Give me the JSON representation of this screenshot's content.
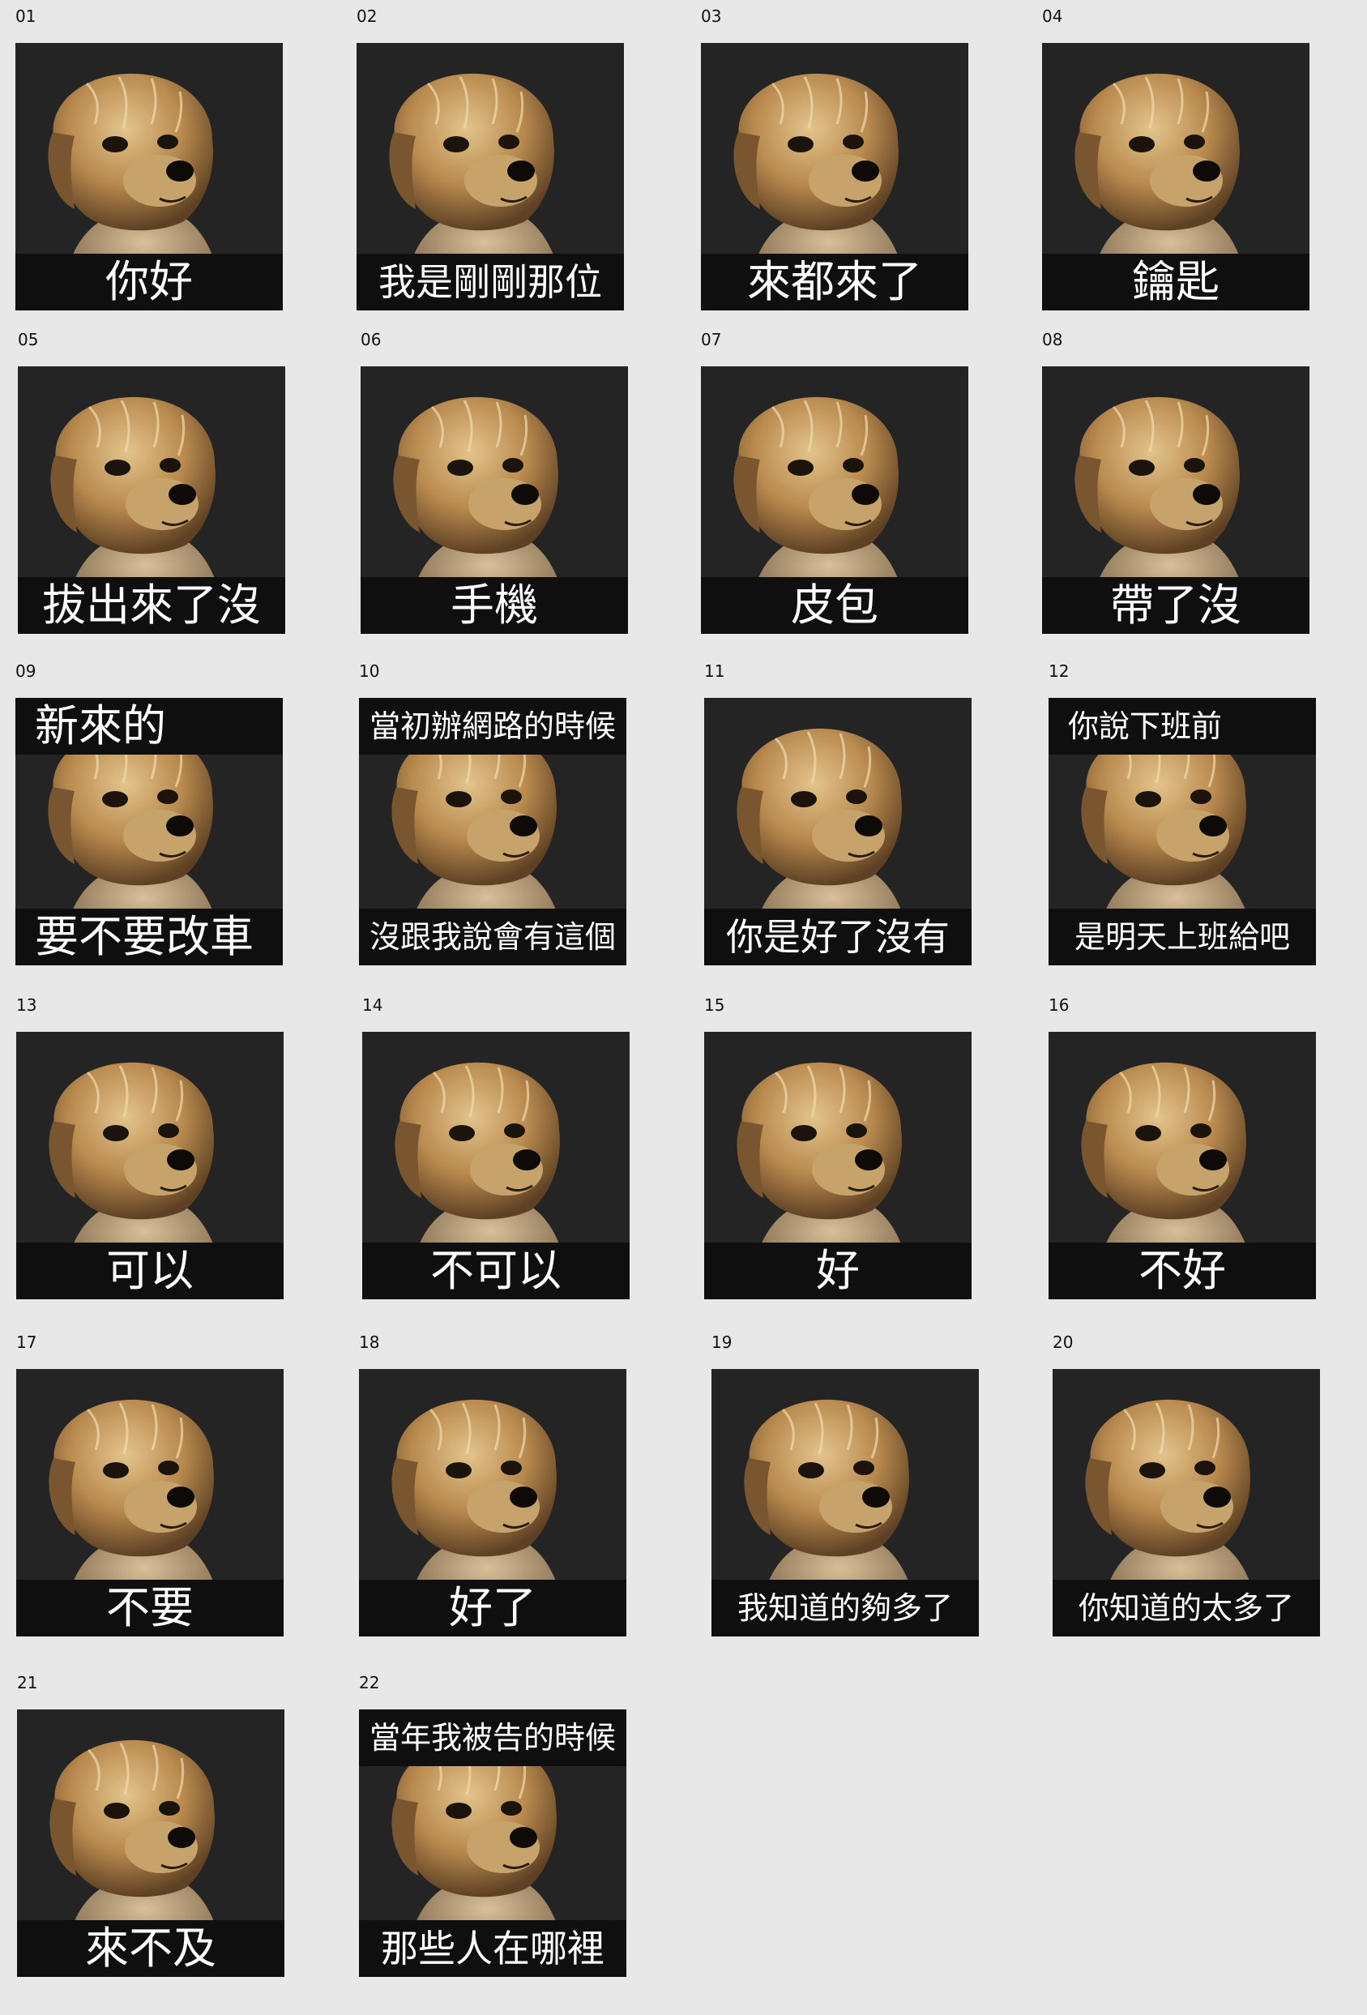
{
  "stickers": [
    {
      "number": "01",
      "bottom": "你好"
    },
    {
      "number": "02",
      "bottom": "我是剛剛那位"
    },
    {
      "number": "03",
      "bottom": "來都來了"
    },
    {
      "number": "04",
      "bottom": "鑰匙"
    },
    {
      "number": "05",
      "bottom": "拔出來了沒"
    },
    {
      "number": "06",
      "bottom": "手機"
    },
    {
      "number": "07",
      "bottom": "皮包"
    },
    {
      "number": "08",
      "bottom": "帶了沒"
    },
    {
      "number": "09",
      "top": "新來的",
      "bottom": "要不要改車"
    },
    {
      "number": "10",
      "top": "當初辦網路的時候",
      "bottom": "沒跟我說會有這個"
    },
    {
      "number": "11",
      "bottom": "你是好了沒有"
    },
    {
      "number": "12",
      "top": "你說下班前",
      "bottom": "是明天上班給吧"
    },
    {
      "number": "13",
      "bottom": "可以"
    },
    {
      "number": "14",
      "bottom": "不可以"
    },
    {
      "number": "15",
      "bottom": "好"
    },
    {
      "number": "16",
      "bottom": "不好"
    },
    {
      "number": "17",
      "bottom": "不要"
    },
    {
      "number": "18",
      "bottom": "好了"
    },
    {
      "number": "19",
      "bottom": "我知道的夠多了"
    },
    {
      "number": "20",
      "bottom": "你知道的太多了"
    },
    {
      "number": "21",
      "bottom": "來不及"
    },
    {
      "number": "22",
      "top": "當年我被告的時候",
      "bottom": "那些人在哪裡"
    }
  ],
  "colors": {
    "page_background": "#e8e8e8",
    "tile_background": "#242424",
    "caption_band": "#0f0f0f",
    "caption_text": "#ffffff",
    "dog_fur": "#c9a36a"
  },
  "image_subject": "yorkshire-terrier-dog-photo"
}
